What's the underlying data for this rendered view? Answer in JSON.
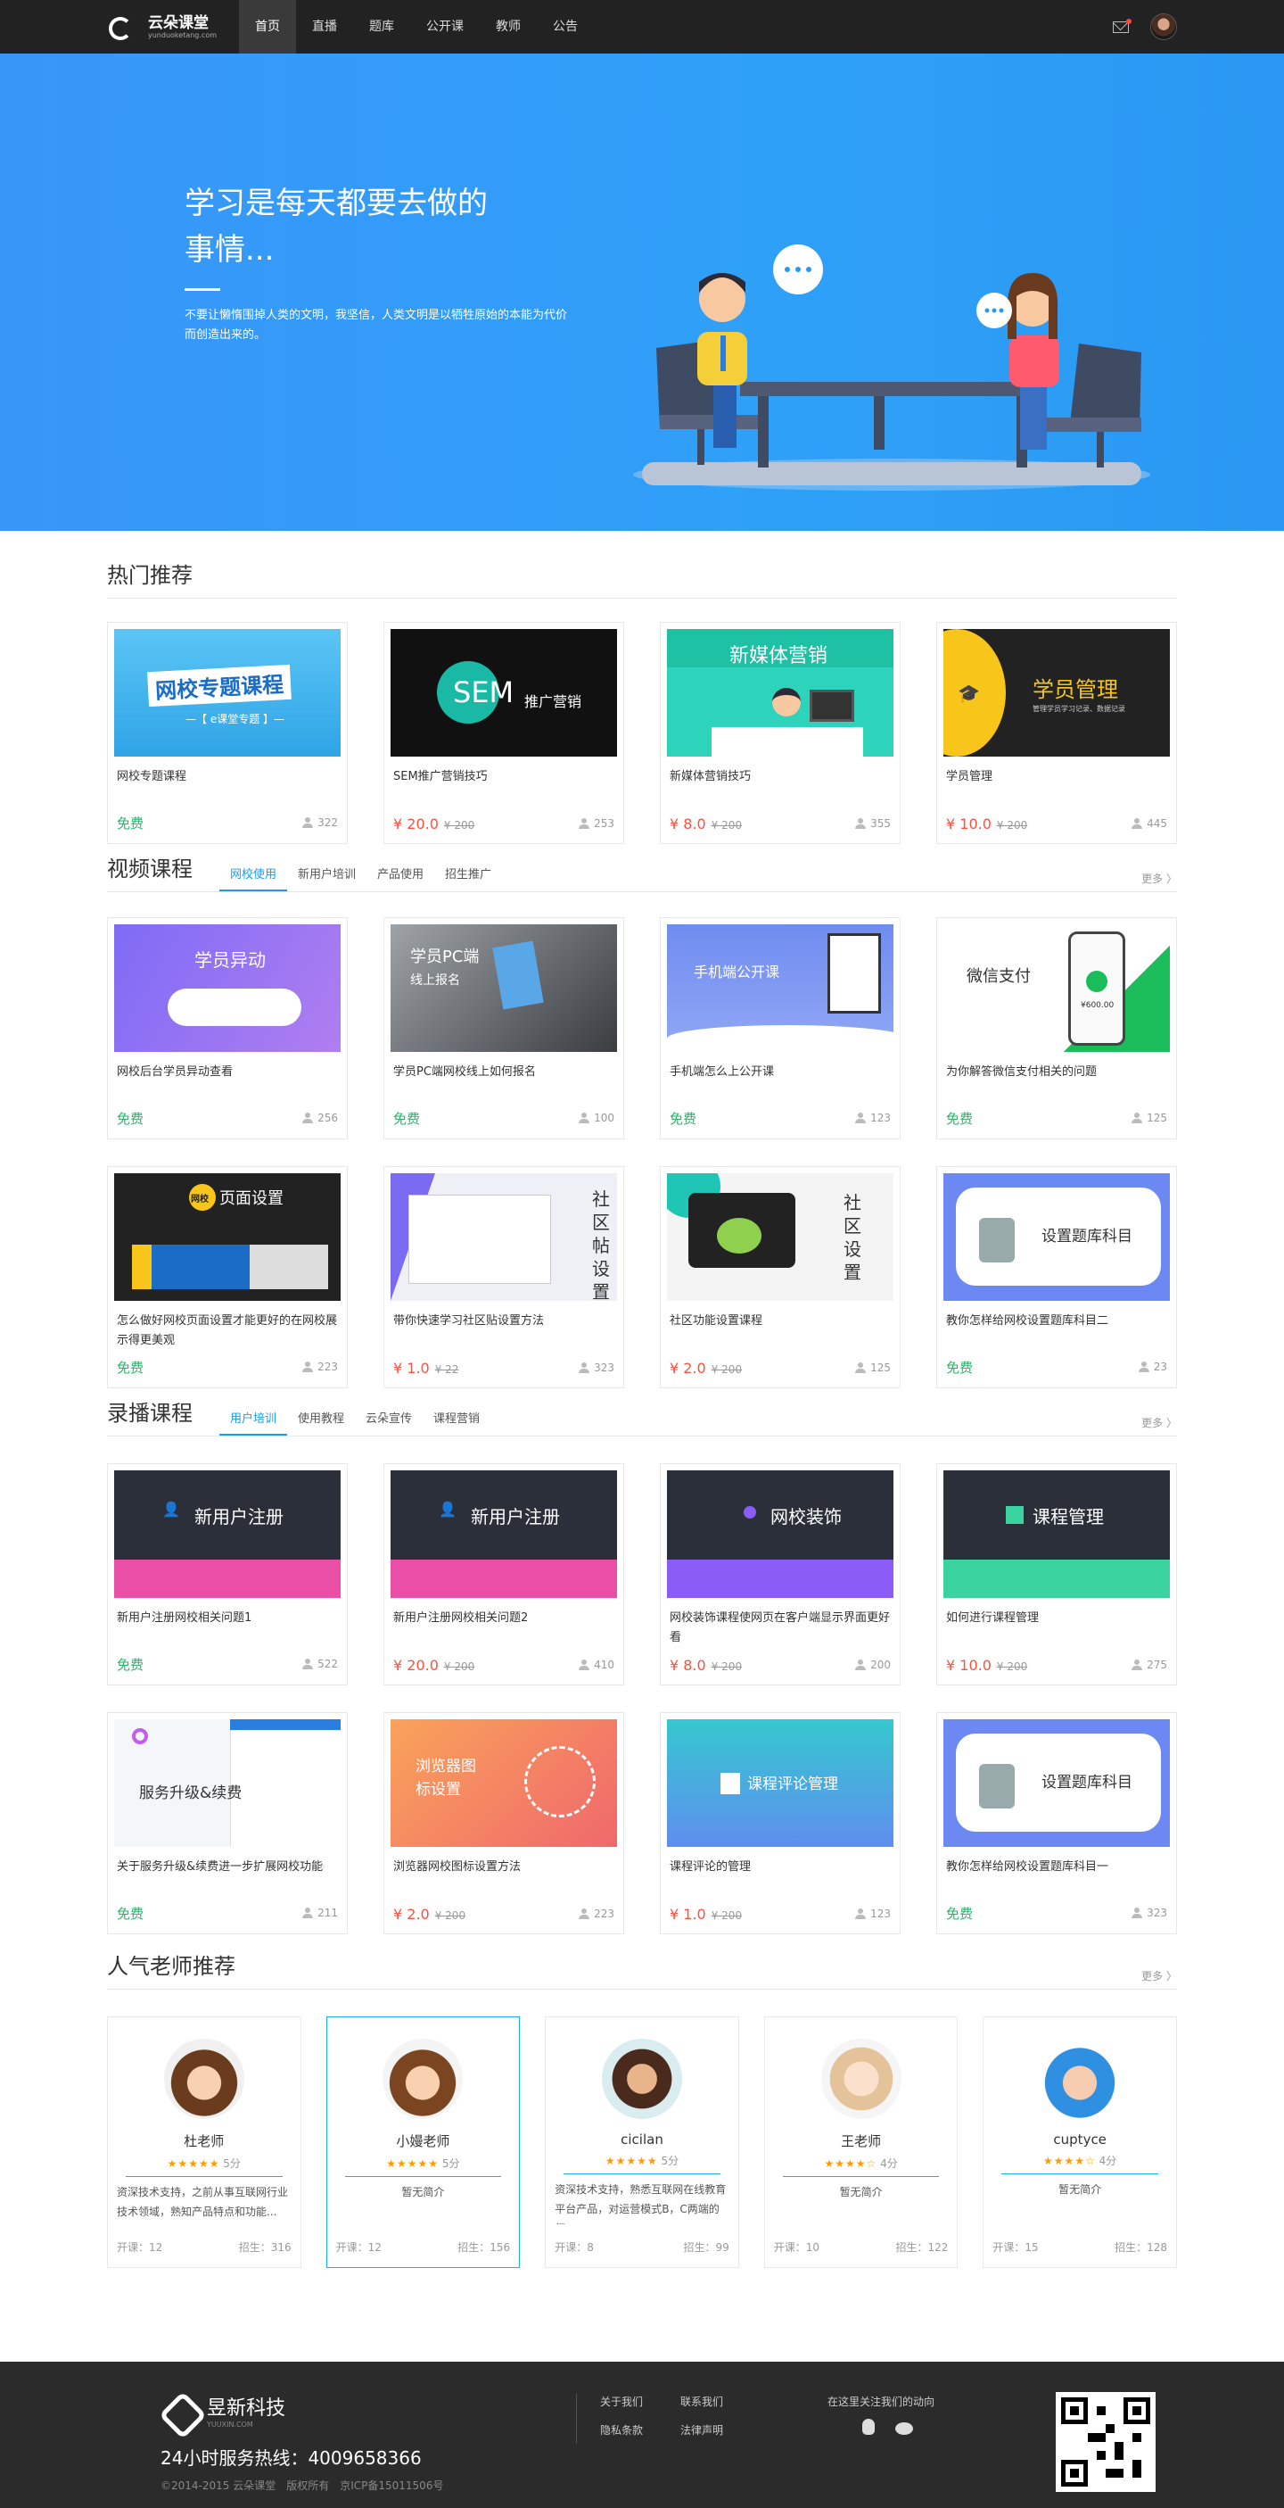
{
  "header": {
    "logo_text": "云朵课堂",
    "logo_sub": "yunduoketang.com",
    "nav": [
      "首页",
      "直播",
      "题库",
      "公开课",
      "教师",
      "公告"
    ],
    "active_index": 0
  },
  "banner": {
    "title": "学习是每天都要去做的事情...",
    "desc": "不要让懒惰围掉人类的文明，我坚信，人类文明是以牺牲原始的本能为代价而创造出来的。"
  },
  "hot": {
    "title": "热门推荐",
    "courses": [
      {
        "thumb_text": "网校专题课程",
        "thumb_sub": "—【 e课堂专题 】—",
        "title": "网校专题课程",
        "price": "免费",
        "old_price": "",
        "count": "322"
      },
      {
        "thumb_text": "SEM",
        "thumb_sub": "推广营销",
        "title": "SEM推广营销技巧",
        "price": "¥ 20.0",
        "old_price": "¥ 200",
        "count": "253"
      },
      {
        "thumb_text": "新媒体营销",
        "thumb_sub": "",
        "title": "新媒体营销技巧",
        "price": "¥ 8.0",
        "old_price": "¥ 200",
        "count": "355"
      },
      {
        "thumb_text": "学员管理",
        "thumb_sub": "管理学员学习记录、数据记录",
        "title": "学员管理",
        "price": "¥ 10.0",
        "old_price": "¥ 200",
        "count": "445"
      }
    ]
  },
  "video": {
    "title": "视频课程",
    "tabs": [
      "网校使用",
      "新用户培训",
      "产品使用",
      "招生推广"
    ],
    "more": "更多 〉",
    "courses": [
      {
        "thumb_text": "学员异动",
        "title": "网校后台学员异动查看",
        "price": "免费",
        "old_price": "",
        "count": "256"
      },
      {
        "thumb_text": "学员PC端",
        "thumb_sub": "线上报名",
        "title": "学员PC端网校线上如何报名",
        "price": "免费",
        "old_price": "",
        "count": "100"
      },
      {
        "thumb_text": "手机端公开课",
        "title": "手机端怎么上公开课",
        "price": "免费",
        "old_price": "",
        "count": "123"
      },
      {
        "thumb_text": "微信支付",
        "thumb_sub": "¥600.00",
        "title": "为你解答微信支付相关的问题",
        "price": "免费",
        "old_price": "",
        "count": "125"
      },
      {
        "thumb_text": "页面设置",
        "thumb_sub": "网校",
        "title": "怎么做好网校页面设置才能更好的在网校展示得更美观",
        "price": "免费",
        "old_price": "",
        "count": "223"
      },
      {
        "thumb_text": "社区帖设置",
        "title": "带你快速学习社区贴设置方法",
        "price": "¥ 1.0",
        "old_price": "¥ 22",
        "count": "323"
      },
      {
        "thumb_text": "社区设置",
        "title": "社区功能设置课程",
        "price": "¥ 2.0",
        "old_price": "¥ 200",
        "count": "125"
      },
      {
        "thumb_text": "设置题库科目",
        "title": "教你怎样给网校设置题库科目二",
        "price": "免费",
        "old_price": "",
        "count": "23"
      }
    ]
  },
  "record": {
    "title": "录播课程",
    "tabs": [
      "用户培训",
      "使用教程",
      "云朵宣传",
      "课程营销"
    ],
    "more": "更多 〉",
    "courses": [
      {
        "thumb_text": "新用户注册",
        "title": "新用户注册网校相关问题1",
        "price": "免费",
        "old_price": "",
        "count": "522"
      },
      {
        "thumb_text": "新用户注册",
        "title": "新用户注册网校相关问题2",
        "price": "¥ 20.0",
        "old_price": "¥ 200",
        "count": "410"
      },
      {
        "thumb_text": "网校装饰",
        "title": "网校装饰课程使网页在客户端显示界面更好看",
        "price": "¥ 8.0",
        "old_price": "¥ 200",
        "count": "200"
      },
      {
        "thumb_text": "课程管理",
        "title": "如何进行课程管理",
        "price": "¥ 10.0",
        "old_price": "¥ 200",
        "count": "275"
      },
      {
        "thumb_text": "服务升级&续费",
        "title": "关于服务升级&续费进一步扩展网校功能",
        "price": "免费",
        "old_price": "",
        "count": "211"
      },
      {
        "thumb_text": "浏览器图标设置",
        "title": "浏览器网校图标设置方法",
        "price": "¥ 2.0",
        "old_price": "¥ 200",
        "count": "223"
      },
      {
        "thumb_text": "课程评论管理",
        "title": "课程评论的管理",
        "price": "¥ 1.0",
        "old_price": "¥ 200",
        "count": "123"
      },
      {
        "thumb_text": "设置题库科目",
        "title": "教你怎样给网校设置题库科目一",
        "price": "免费",
        "old_price": "",
        "count": "323"
      }
    ]
  },
  "teachers": {
    "title": "人气老师推荐",
    "more": "更多 〉",
    "list": [
      {
        "name": "杜老师",
        "stars": "★★★★★",
        "score": "5分",
        "intro": "资深技术支持，之前从事互联网行业技术领域，熟知产品特点和功能...",
        "courses": "开课：12",
        "students": "招生：316"
      },
      {
        "name": "小嫚老师",
        "stars": "★★★★★",
        "score": "5分",
        "intro": "暂无简介",
        "courses": "开课：12",
        "students": "招生：156"
      },
      {
        "name": "cicilan",
        "stars": "★★★★★",
        "score": "5分",
        "intro": "资深技术支持，熟悉互联网在线教育平台产品，对运营模式B，C两端的行",
        "courses": "开课：8",
        "students": "招生：99"
      },
      {
        "name": "王老师",
        "stars": "★★★★☆",
        "score": "4分",
        "intro": "暂无简介",
        "courses": "开课：10",
        "students": "招生：122"
      },
      {
        "name": "cuptyce",
        "stars": "★★★★☆",
        "score": "4分",
        "intro": "暂无简介",
        "courses": "开课：15",
        "students": "招生：128"
      }
    ]
  },
  "footer": {
    "brand": "昱新科技",
    "brand_sub": "YUUXIN.COM",
    "hotline": "24小时服务热线：4009658366",
    "copyright": "©2014-2015 云朵课堂　版权所有　京ICP备15011506号",
    "links": [
      "关于我们",
      "联系我们",
      "隐私条款",
      "法律声明"
    ],
    "follow": "在这里关注我们的动向"
  },
  "colors": {
    "accent": "#1a9cf0",
    "free": "#27b56a",
    "price": "#ff4f3f",
    "banner": "#3896f8"
  }
}
